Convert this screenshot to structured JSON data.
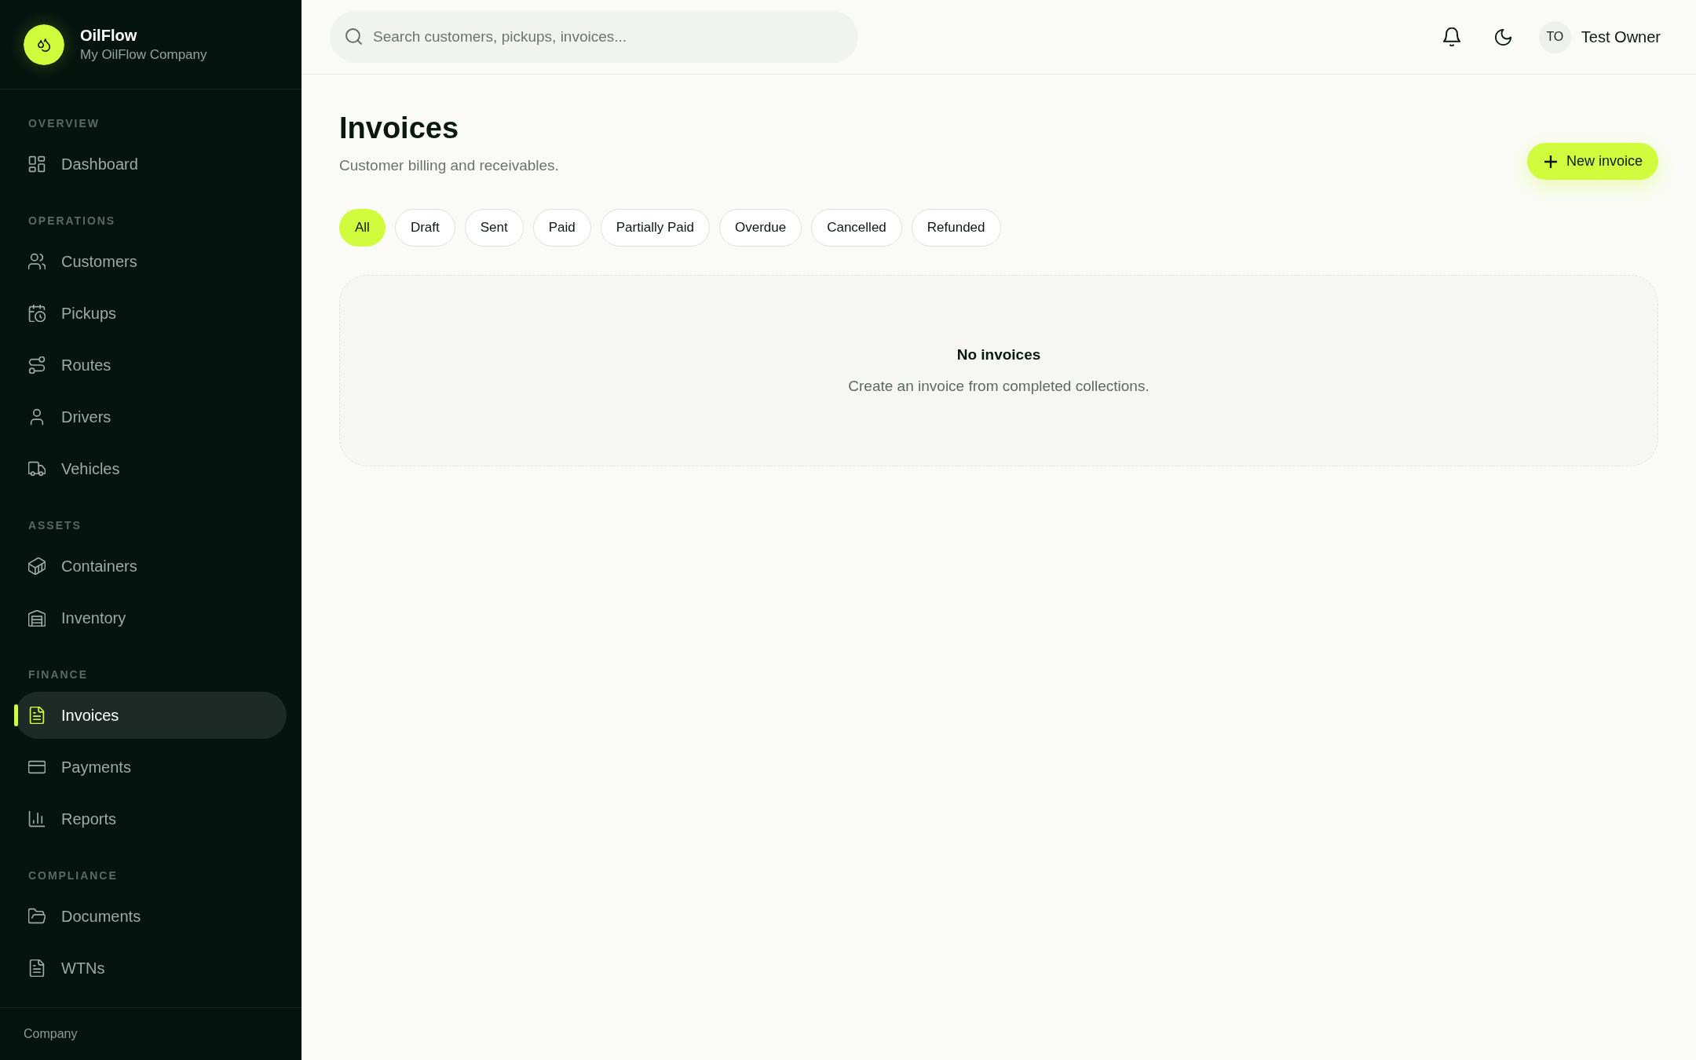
{
  "sidebar": {
    "brand": {
      "name": "OilFlow",
      "company": "My OilFlow Company"
    },
    "sections": [
      {
        "label": "OVERVIEW",
        "items": [
          {
            "label": "Dashboard",
            "selected": false
          }
        ]
      },
      {
        "label": "OPERATIONS",
        "items": [
          {
            "label": "Customers",
            "selected": false
          },
          {
            "label": "Pickups",
            "selected": false
          },
          {
            "label": "Routes",
            "selected": false
          },
          {
            "label": "Drivers",
            "selected": false
          },
          {
            "label": "Vehicles",
            "selected": false
          }
        ]
      },
      {
        "label": "ASSETS",
        "items": [
          {
            "label": "Containers",
            "selected": false
          },
          {
            "label": "Inventory",
            "selected": false
          }
        ]
      },
      {
        "label": "FINANCE",
        "items": [
          {
            "label": "Invoices",
            "selected": true
          },
          {
            "label": "Payments",
            "selected": false
          },
          {
            "label": "Reports",
            "selected": false
          }
        ]
      },
      {
        "label": "COMPLIANCE",
        "items": [
          {
            "label": "Documents",
            "selected": false
          },
          {
            "label": "WTNs",
            "selected": false
          }
        ]
      }
    ],
    "footer": "Company"
  },
  "topbar": {
    "search": {
      "placeholder": "Search customers, pickups, invoices..."
    },
    "user": {
      "initials": "TO",
      "name": "Test Owner"
    }
  },
  "page": {
    "title": "Invoices",
    "subtitle": "Customer billing and receivables.",
    "primary_button": "New invoice",
    "filters": [
      {
        "label": "All",
        "selected": true
      },
      {
        "label": "Draft",
        "selected": false
      },
      {
        "label": "Sent",
        "selected": false
      },
      {
        "label": "Paid",
        "selected": false
      },
      {
        "label": "Partially Paid",
        "selected": false
      },
      {
        "label": "Overdue",
        "selected": false
      },
      {
        "label": "Cancelled",
        "selected": false
      },
      {
        "label": "Refunded",
        "selected": false
      }
    ],
    "empty_state": {
      "title": "No invoices",
      "message": "Create an invoice from completed collections."
    }
  }
}
